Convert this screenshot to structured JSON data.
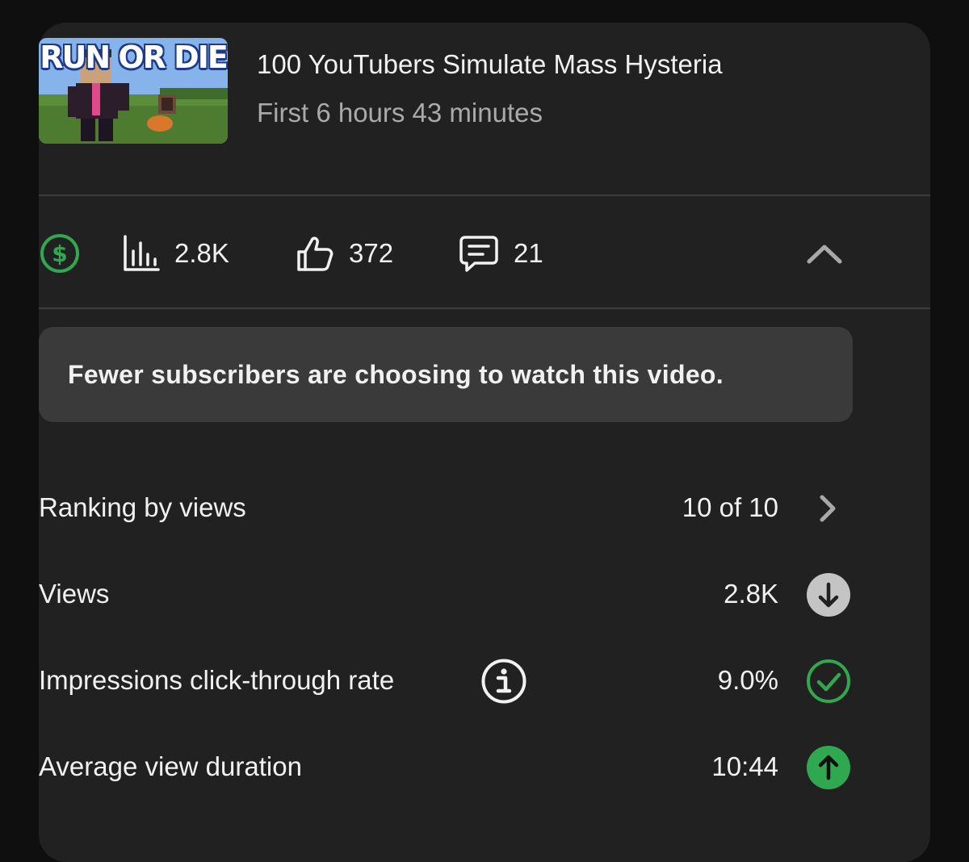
{
  "video": {
    "title": "100 YouTubers Simulate Mass Hysteria",
    "subtitle": "First 6 hours 43 minutes",
    "thumbnail_text": "RUN OR DIE"
  },
  "stats": {
    "views": "2.8K",
    "likes": "372",
    "comments": "21"
  },
  "notice": {
    "text": "Fewer subscribers are choosing to watch this video."
  },
  "metrics": [
    {
      "label": "Ranking by views",
      "value": "10 of 10",
      "icon": "chevron-right-icon"
    },
    {
      "label": "Views",
      "value": "2.8K",
      "icon": "arrow-down-circle-icon"
    },
    {
      "label": "Impressions click-through rate",
      "value": "9.0%",
      "icon": "check-circle-icon"
    },
    {
      "label": "Average view duration",
      "value": "10:44",
      "icon": "arrow-up-circle-icon"
    }
  ],
  "colors": {
    "background": "#0f0f0f",
    "card": "#212121",
    "notice": "#3a3a3a",
    "green": "#2fa84f",
    "gray_badge": "#c4c4c4",
    "divider": "#3d3d3d"
  }
}
